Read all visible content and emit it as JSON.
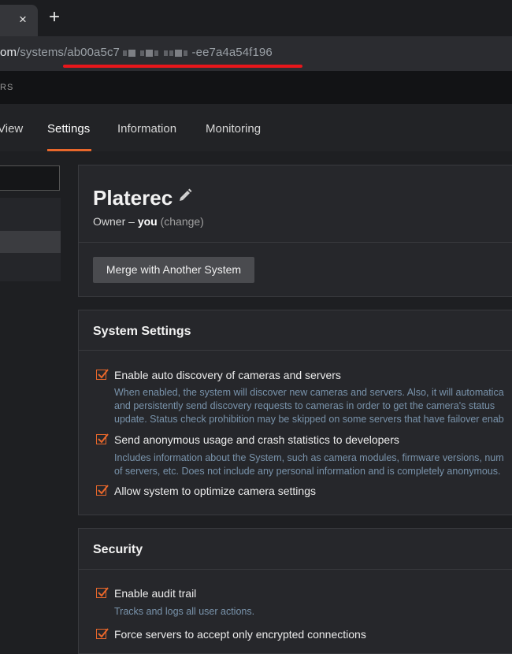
{
  "browser": {
    "tab_close": "×",
    "new_tab": "+",
    "url_host": "om",
    "url_path_prefix": "/systems/ab00a5c7",
    "url_path_suffix": "-ee7a4a54f196"
  },
  "app_header": {
    "crumb": "RS"
  },
  "nav": {
    "tabs": [
      {
        "label": "View"
      },
      {
        "label": "Settings"
      },
      {
        "label": "Information"
      },
      {
        "label": "Monitoring"
      }
    ]
  },
  "system": {
    "name": "Platerec",
    "owner_prefix": "Owner – ",
    "owner_name": "you",
    "owner_change": "(change)",
    "merge_button": "Merge with Another System"
  },
  "system_settings": {
    "title": "System Settings",
    "options": [
      {
        "label": "Enable auto discovery of cameras and servers",
        "checked": true,
        "desc": [
          "When enabled, the system will discover new cameras and servers. Also, it will automatica",
          "and persistently send discovery requests to cameras in order to get the camera's status",
          "update. Status check prohibition may be skipped on some servers that have failover enab"
        ]
      },
      {
        "label": "Send anonymous usage and crash statistics to developers",
        "checked": true,
        "desc": [
          "Includes information about the System, such as camera modules, firmware versions, num",
          "of servers, etc. Does not include any personal information and is completely anonymous."
        ]
      },
      {
        "label": "Allow system to optimize camera settings",
        "checked": true,
        "desc": []
      }
    ]
  },
  "security": {
    "title": "Security",
    "options": [
      {
        "label": "Enable audit trail",
        "checked": true,
        "desc": [
          "Tracks and logs all user actions."
        ]
      },
      {
        "label": "Force servers to accept only encrypted connections",
        "checked": true,
        "desc": []
      }
    ]
  },
  "colors": {
    "accent": "#e8672b",
    "annotation": "#e8161b",
    "description": "#7993ab"
  }
}
